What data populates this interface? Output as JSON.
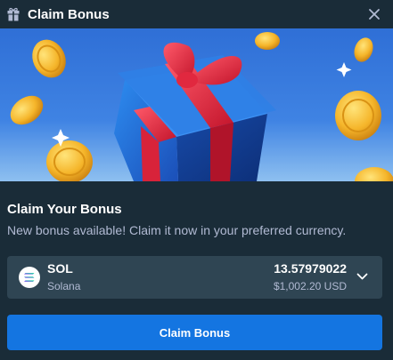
{
  "header": {
    "title": "Claim Bonus",
    "icon": "gift-icon",
    "close_icon": "close-icon"
  },
  "banner": {
    "image": "gift-box-with-gold-coins",
    "background_color": "#2a64c8"
  },
  "bonus": {
    "heading": "Claim Your Bonus",
    "description": "New bonus available! Claim it now in your preferred currency."
  },
  "currency": {
    "code": "SOL",
    "name": "Solana",
    "amount": "13.57979022",
    "usd_value": "$1,002.20 USD",
    "icon": "solana-icon",
    "dropdown_icon": "chevron-down-icon"
  },
  "actions": {
    "claim_label": "Claim Bonus"
  },
  "colors": {
    "background": "#1a2c38",
    "panel": "#2f4553",
    "accent": "#1475e1",
    "muted_text": "#b1bad3"
  }
}
